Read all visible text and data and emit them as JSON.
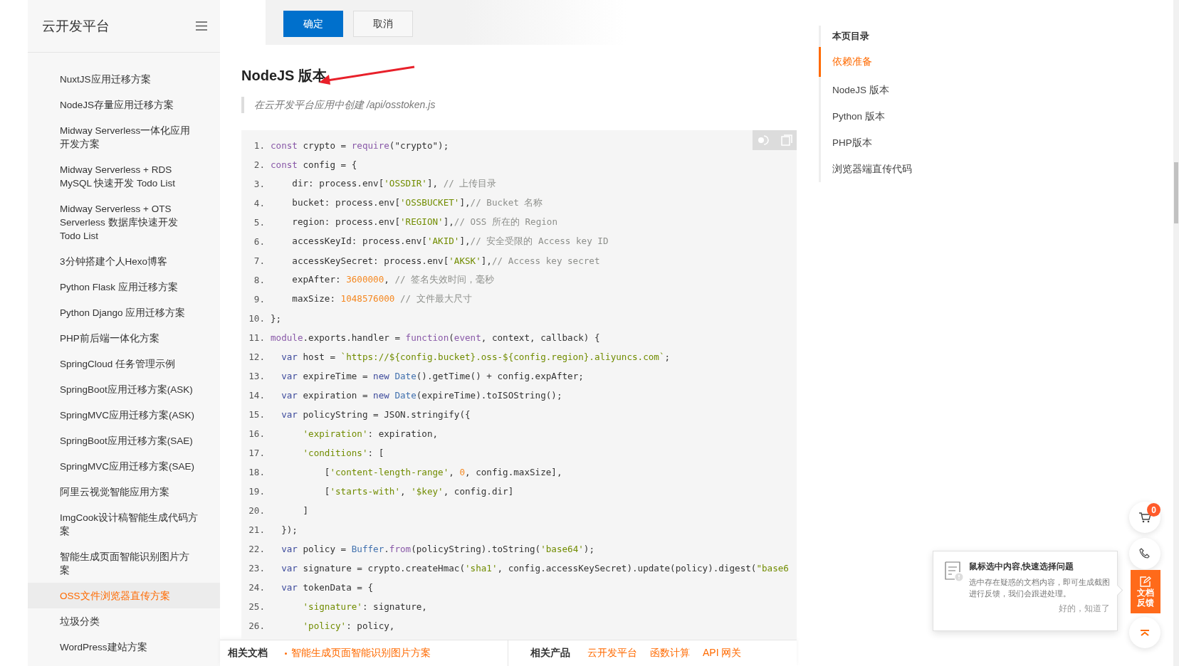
{
  "sidebar": {
    "title": "云开发平台",
    "items": [
      {
        "label": "NuxtJS应用迁移方案",
        "selected": false
      },
      {
        "label": "NodeJS存量应用迁移方案",
        "selected": false
      },
      {
        "label": "Midway Serverless一体化应用开发方案",
        "selected": false
      },
      {
        "label": "Midway Serverless + RDS MySQL 快速开发 Todo List",
        "selected": false
      },
      {
        "label": "Midway Serverless + OTS Serverless 数据库快速开发 Todo List",
        "selected": false
      },
      {
        "label": "3分钟搭建个人Hexo博客",
        "selected": false
      },
      {
        "label": "Python Flask 应用迁移方案",
        "selected": false
      },
      {
        "label": "Python Django 应用迁移方案",
        "selected": false
      },
      {
        "label": "PHP前后端一体化方案",
        "selected": false
      },
      {
        "label": "SpringCloud 任务管理示例",
        "selected": false
      },
      {
        "label": "SpringBoot应用迁移方案(ASK)",
        "selected": false
      },
      {
        "label": "SpringMVC应用迁移方案(ASK)",
        "selected": false
      },
      {
        "label": "SpringBoot应用迁移方案(SAE)",
        "selected": false
      },
      {
        "label": "SpringMVC应用迁移方案(SAE)",
        "selected": false
      },
      {
        "label": "阿里云视觉智能应用方案",
        "selected": false
      },
      {
        "label": "ImgCook设计稿智能生成代码方案",
        "selected": false
      },
      {
        "label": "智能生成页面智能识别图片方案",
        "selected": false
      },
      {
        "label": "OSS文件浏览器直传方案",
        "selected": true
      },
      {
        "label": "垃圾分类",
        "selected": false
      },
      {
        "label": "WordPress建站方案",
        "selected": false
      }
    ]
  },
  "dialog_buttons": [
    {
      "label": "确定",
      "kind": "primary"
    },
    {
      "label": "取消",
      "kind": "secondary"
    }
  ],
  "heading": "NodeJS 版本",
  "note": "在云开发平台应用中创建 /api/osstoken.js",
  "code": {
    "lines": [
      {
        "number": "1.",
        "tokens": [
          {
            "kind": "kw",
            "text": "const"
          },
          {
            "kind": "plain",
            "text": " crypto = "
          },
          {
            "kind": "kw",
            "text": "require"
          },
          {
            "kind": "plain",
            "text": "(\"crypto\");"
          }
        ]
      },
      {
        "number": "2.",
        "tokens": [
          {
            "kind": "kw",
            "text": "const"
          },
          {
            "kind": "plain",
            "text": " config = {"
          }
        ]
      },
      {
        "number": "3.",
        "tokens": [
          {
            "kind": "plain",
            "text": "    dir: process.env["
          },
          {
            "kind": "str",
            "text": "'OSSDIR'"
          },
          {
            "kind": "plain",
            "text": "], "
          },
          {
            "kind": "cmt",
            "text": "// 上传目录"
          }
        ]
      },
      {
        "number": "4.",
        "tokens": [
          {
            "kind": "plain",
            "text": "    bucket: process.env["
          },
          {
            "kind": "str",
            "text": "'OSSBUCKET'"
          },
          {
            "kind": "plain",
            "text": "],"
          },
          {
            "kind": "cmt",
            "text": "// Bucket 名称"
          }
        ]
      },
      {
        "number": "5.",
        "tokens": [
          {
            "kind": "plain",
            "text": "    region: process.env["
          },
          {
            "kind": "str",
            "text": "'REGION'"
          },
          {
            "kind": "plain",
            "text": "],"
          },
          {
            "kind": "cmt",
            "text": "// OSS 所在的 Region"
          }
        ]
      },
      {
        "number": "6.",
        "tokens": [
          {
            "kind": "plain",
            "text": "    accessKeyId: process.env["
          },
          {
            "kind": "str",
            "text": "'AKID'"
          },
          {
            "kind": "plain",
            "text": "],"
          },
          {
            "kind": "cmt",
            "text": "// 安全受限的 Access key ID"
          }
        ]
      },
      {
        "number": "7.",
        "tokens": [
          {
            "kind": "plain",
            "text": "    accessKeySecret: process.env["
          },
          {
            "kind": "str",
            "text": "'AKSK'"
          },
          {
            "kind": "plain",
            "text": "],"
          },
          {
            "kind": "cmt",
            "text": "// Access key secret"
          }
        ]
      },
      {
        "number": "8.",
        "tokens": [
          {
            "kind": "plain",
            "text": "    expAfter: "
          },
          {
            "kind": "num",
            "text": "3600000"
          },
          {
            "kind": "plain",
            "text": ", "
          },
          {
            "kind": "cmt",
            "text": "// 签名失效时间，毫秒"
          }
        ]
      },
      {
        "number": "9.",
        "tokens": [
          {
            "kind": "plain",
            "text": "    maxSize: "
          },
          {
            "kind": "num",
            "text": "1048576000"
          },
          {
            "kind": "cmt",
            "text": " // 文件最大尺寸"
          }
        ]
      },
      {
        "number": "10.",
        "tokens": [
          {
            "kind": "plain",
            "text": "};"
          }
        ]
      },
      {
        "number": "11.",
        "tokens": [
          {
            "kind": "kw",
            "text": "module"
          },
          {
            "kind": "plain",
            "text": ".exports.handler = "
          },
          {
            "kind": "kw",
            "text": "function"
          },
          {
            "kind": "plain",
            "text": "("
          },
          {
            "kind": "kw",
            "text": "event"
          },
          {
            "kind": "plain",
            "text": ", context, callback) {"
          }
        ]
      },
      {
        "number": "12.",
        "tokens": [
          {
            "kind": "var",
            "text": "  var"
          },
          {
            "kind": "plain",
            "text": " host = "
          },
          {
            "kind": "str",
            "text": "`https://${config.bucket}.oss-${config.region}.aliyuncs.com`"
          },
          {
            "kind": "plain",
            "text": ";"
          }
        ]
      },
      {
        "number": "13.",
        "tokens": [
          {
            "kind": "var",
            "text": "  var"
          },
          {
            "kind": "plain",
            "text": " expireTime = "
          },
          {
            "kind": "var",
            "text": "new "
          },
          {
            "kind": "cls",
            "text": "Date"
          },
          {
            "kind": "plain",
            "text": "().getTime() + config.expAfter;"
          }
        ]
      },
      {
        "number": "14.",
        "tokens": [
          {
            "kind": "var",
            "text": "  var"
          },
          {
            "kind": "plain",
            "text": " expiration = "
          },
          {
            "kind": "var",
            "text": "new "
          },
          {
            "kind": "cls",
            "text": "Date"
          },
          {
            "kind": "plain",
            "text": "(expireTime).toISOString();"
          }
        ]
      },
      {
        "number": "15.",
        "tokens": [
          {
            "kind": "var",
            "text": "  var"
          },
          {
            "kind": "plain",
            "text": " policyString = JSON.stringify({"
          }
        ]
      },
      {
        "number": "16.",
        "tokens": [
          {
            "kind": "str",
            "text": "      'expiration'"
          },
          {
            "kind": "plain",
            "text": ": expiration,"
          }
        ]
      },
      {
        "number": "17.",
        "tokens": [
          {
            "kind": "str",
            "text": "      'conditions'"
          },
          {
            "kind": "plain",
            "text": ": ["
          }
        ]
      },
      {
        "number": "18.",
        "tokens": [
          {
            "kind": "plain",
            "text": "          ["
          },
          {
            "kind": "str",
            "text": "'content-length-range'"
          },
          {
            "kind": "plain",
            "text": ", "
          },
          {
            "kind": "num",
            "text": "0"
          },
          {
            "kind": "plain",
            "text": ", config.maxSize],"
          }
        ]
      },
      {
        "number": "19.",
        "tokens": [
          {
            "kind": "plain",
            "text": "          ["
          },
          {
            "kind": "str",
            "text": "'starts-with'"
          },
          {
            "kind": "plain",
            "text": ", "
          },
          {
            "kind": "str",
            "text": "'$key'"
          },
          {
            "kind": "plain",
            "text": ", config.dir]"
          }
        ]
      },
      {
        "number": "20.",
        "tokens": [
          {
            "kind": "plain",
            "text": "      ]"
          }
        ]
      },
      {
        "number": "21.",
        "tokens": [
          {
            "kind": "plain",
            "text": "  });"
          }
        ]
      },
      {
        "number": "22.",
        "tokens": [
          {
            "kind": "var",
            "text": "  var"
          },
          {
            "kind": "plain",
            "text": " policy = "
          },
          {
            "kind": "cls",
            "text": "Buffer"
          },
          {
            "kind": "plain",
            "text": "."
          },
          {
            "kind": "kw",
            "text": "from"
          },
          {
            "kind": "plain",
            "text": "(policyString).toString("
          },
          {
            "kind": "str",
            "text": "'base64'"
          },
          {
            "kind": "plain",
            "text": ");"
          }
        ]
      },
      {
        "number": "23.",
        "tokens": [
          {
            "kind": "var",
            "text": "  var"
          },
          {
            "kind": "plain",
            "text": " signature = crypto.createHmac("
          },
          {
            "kind": "str",
            "text": "'sha1'"
          },
          {
            "kind": "plain",
            "text": ", config.accessKeySecret).update(policy).digest("
          },
          {
            "kind": "str",
            "text": "\"base6"
          }
        ]
      },
      {
        "number": "24.",
        "tokens": [
          {
            "kind": "var",
            "text": "  var"
          },
          {
            "kind": "plain",
            "text": " tokenData = {"
          }
        ]
      },
      {
        "number": "25.",
        "tokens": [
          {
            "kind": "str",
            "text": "      'signature'"
          },
          {
            "kind": "plain",
            "text": ": signature,"
          }
        ]
      },
      {
        "number": "26.",
        "tokens": [
          {
            "kind": "str",
            "text": "      'policy'"
          },
          {
            "kind": "plain",
            "text": ": policy,"
          }
        ]
      }
    ]
  },
  "toc": {
    "title": "本页目录",
    "items": [
      {
        "label": "依赖准备",
        "selected": true
      },
      {
        "label": "NodeJS 版本",
        "selected": false
      },
      {
        "label": "Python 版本",
        "selected": false
      },
      {
        "label": "PHP版本",
        "selected": false
      },
      {
        "label": "浏览器端直传代码",
        "selected": false
      }
    ]
  },
  "float": {
    "cart_count": "0",
    "feedback_label": "文档反馈"
  },
  "tip": {
    "title": "鼠标选中内容,快速选择问题",
    "text": "选中存在疑惑的文档内容，即可生成截图进行反馈，我们会跟进处理。",
    "action": "好的，知道了"
  },
  "related": {
    "docs_label": "相关文档",
    "docs": [
      "智能生成页面智能识别图片方案"
    ],
    "products_label": "相关产品",
    "products": [
      "云开发平台",
      "函数计算",
      "API 网关"
    ]
  }
}
